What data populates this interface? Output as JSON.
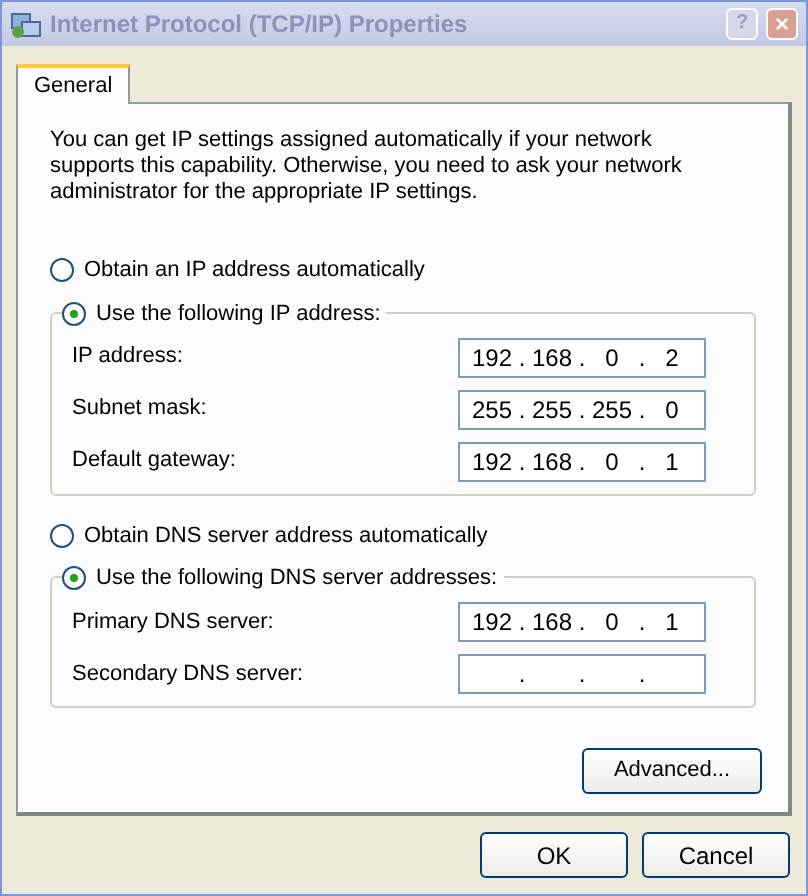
{
  "window": {
    "title": "Internet Protocol (TCP/IP) Properties",
    "help_button": "?",
    "close_button": "×"
  },
  "tabs": [
    {
      "label": "General",
      "selected": true
    }
  ],
  "description": "You can get IP settings assigned automatically if your network supports this capability. Otherwise, you need to ask your network administrator for the appropriate IP settings.",
  "ip_options": [
    {
      "label": "Obtain an IP address automatically",
      "selected": false
    },
    {
      "label": "Use the following IP address:",
      "selected": true
    }
  ],
  "ip_fields": [
    {
      "label": "IP address:",
      "octets": [
        "192",
        "168",
        "0",
        "2"
      ],
      "separators": [
        ".",
        ".",
        "."
      ]
    },
    {
      "label": "Subnet mask:",
      "octets": [
        "255",
        "255",
        "255",
        "0"
      ],
      "separators": [
        ".",
        ".",
        "."
      ]
    },
    {
      "label": "Default gateway:",
      "octets": [
        "192",
        "168",
        "0",
        "1"
      ],
      "separators": [
        ".",
        ".",
        "."
      ]
    }
  ],
  "dns_options": [
    {
      "label": "Obtain DNS server address automatically",
      "selected": false
    },
    {
      "label": "Use the following DNS server addresses:",
      "selected": true
    }
  ],
  "dns_fields": [
    {
      "label": "Primary DNS server:",
      "octets": [
        "192",
        "168",
        "0",
        "1"
      ],
      "separators": [
        ".",
        ".",
        "."
      ]
    },
    {
      "label": "Secondary DNS server:",
      "separators": [
        ".",
        ".",
        "."
      ]
    }
  ],
  "advanced_button": "Advanced...",
  "buttons": [
    "OK",
    "Cancel"
  ]
}
